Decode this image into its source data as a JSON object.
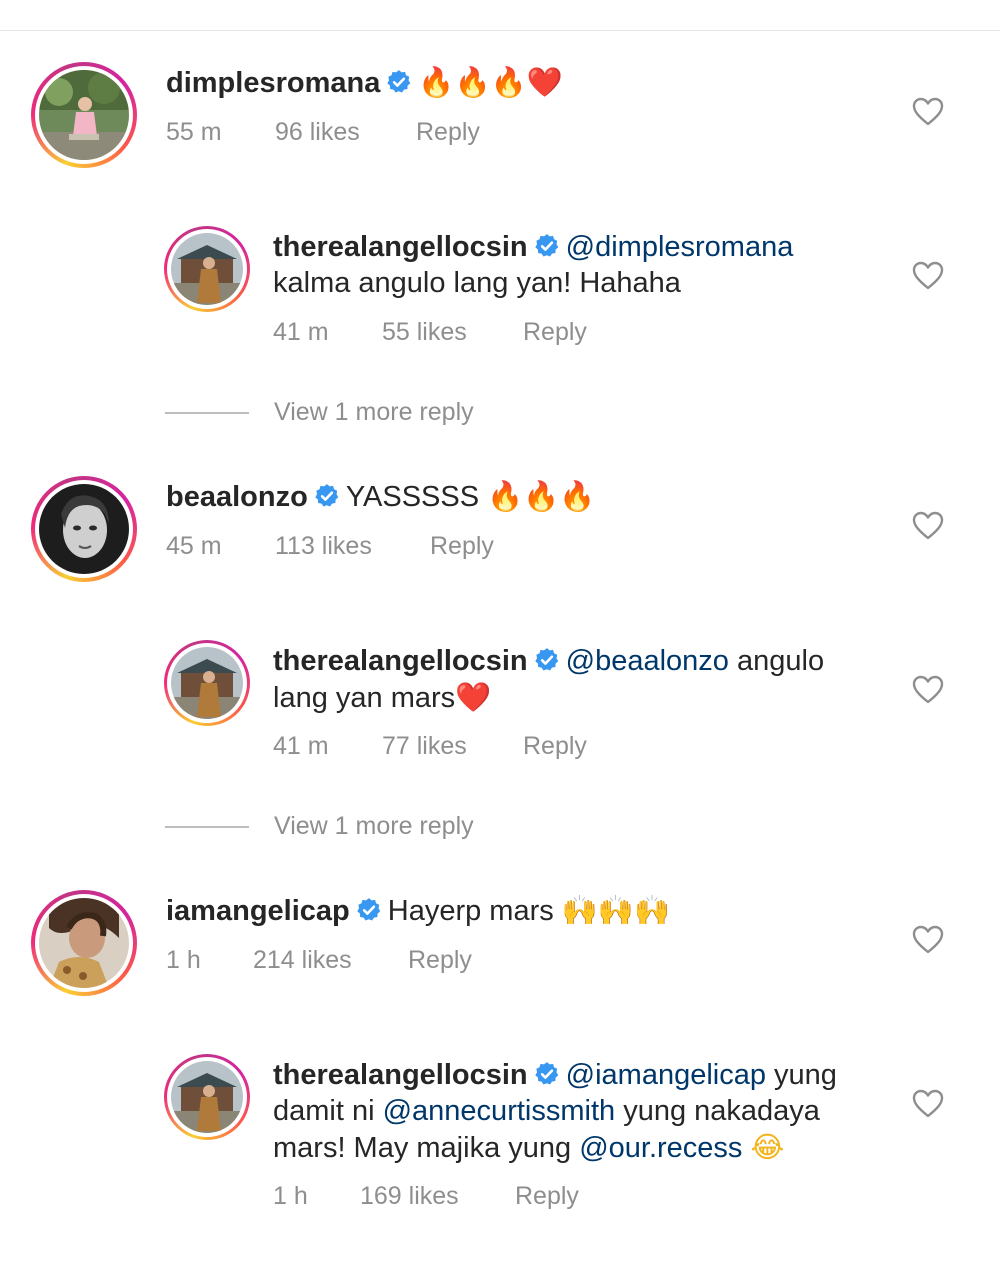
{
  "comments": [
    {
      "username": "dimplesromana",
      "text": "",
      "emoji": "🔥🔥🔥❤️",
      "time": "55 m",
      "likes": "96 likes",
      "reply": "Reply",
      "avatar": "woman-sitting-garden"
    },
    {
      "username": "therealangellocsin",
      "mention": "@dimplesromana",
      "text_line1_rest": "",
      "text_line2": "kalma angulo lang yan! Hahaha",
      "time": "41 m",
      "likes": "55 likes",
      "reply": "Reply",
      "avatar": "woman-temple"
    },
    {
      "view_more": "View 1 more reply"
    },
    {
      "username": "beaalonzo",
      "text": "YASSSSS",
      "emoji": "🔥🔥🔥",
      "time": "45 m",
      "likes": "113 likes",
      "reply": "Reply",
      "avatar": "woman-portrait-bw"
    },
    {
      "username": "therealangellocsin",
      "mention": "@beaalonzo",
      "text_line1_rest": " angulo",
      "text_line2": "lang yan mars",
      "emoji": "❤️",
      "time": "41 m",
      "likes": "77 likes",
      "reply": "Reply",
      "avatar": "woman-temple"
    },
    {
      "view_more": "View 1 more reply"
    },
    {
      "username": "iamangelicap",
      "text": "Hayerp mars",
      "emoji": "🙌🙌🙌",
      "time": "1 h",
      "likes": "214 likes",
      "reply": "Reply",
      "avatar": "woman-smiling"
    },
    {
      "username": "therealangellocsin",
      "mention": "@iamangelicap",
      "text_line1_rest": " yung",
      "line2_a": "damit ni ",
      "line2_mention": "@annecurtissmith",
      "line2_b": " yung nakadaya",
      "line3_a": "mars! May majika yung ",
      "line3_mention": "@our.recess",
      "emoji": "😂",
      "time": "1 h",
      "likes": "169 likes",
      "reply": "Reply",
      "avatar": "woman-temple"
    }
  ],
  "colors": {
    "text": "#262626",
    "meta": "#8e8e8e",
    "mention": "#00376b",
    "verified": "#3897f0"
  },
  "icons": {
    "verified": "verified-badge-icon",
    "like": "heart-outline-icon"
  }
}
